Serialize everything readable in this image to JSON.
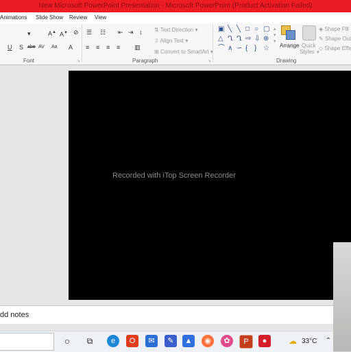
{
  "window": {
    "title": "New Microsoft PowerPoint Presentation - Microsoft PowerPoint (Product Activation Failed)"
  },
  "ribbon_tabs": [
    {
      "label": "Animations"
    },
    {
      "label": "Slide Show"
    },
    {
      "label": "Review"
    },
    {
      "label": "View"
    }
  ],
  "groups": {
    "font": "Font",
    "paragraph": "Paragraph",
    "drawing": "Drawing"
  },
  "paragraph": {
    "text_direction": "Text Direction",
    "align_text": "Align Text",
    "convert_smartart": "Convert to SmartArt"
  },
  "drawing": {
    "arrange": "Arrange",
    "quick_styles_1": "Quick",
    "quick_styles_2": "Styles",
    "shape_fill": "Shape Fill",
    "shape_outline": "Shape Outline",
    "shape_effects": "Shape Effects"
  },
  "slide": {
    "text": "Recorded with iTop Screen Recorder"
  },
  "notes": {
    "placeholder": "dd notes"
  },
  "taskbar": {
    "temperature": "33°C"
  },
  "colors": {
    "title_bar": "#ec1c24",
    "slide_bg": "#000000",
    "ribbon_bg": "#f6f6f6"
  }
}
